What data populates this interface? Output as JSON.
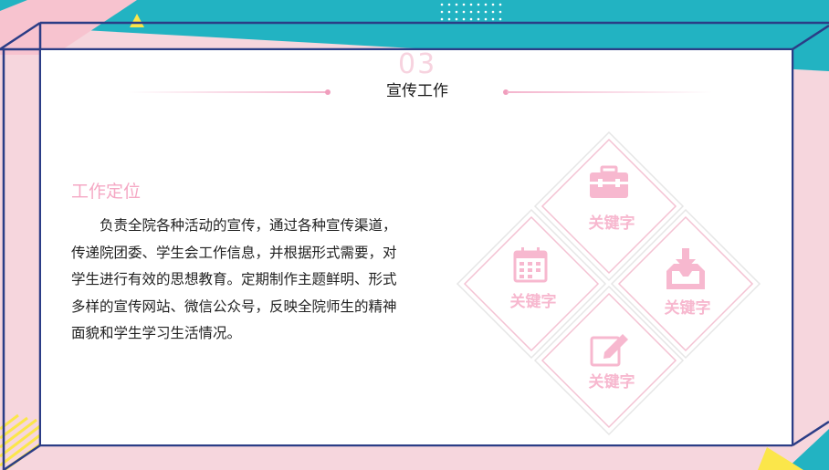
{
  "section": {
    "number": "03",
    "title": "宣传工作"
  },
  "content": {
    "subtitle": "工作定位",
    "paragraph": "负责全院各种活动的宣传，通过各种宣传渠道，传递院团委、学生会工作信息，并根据形式需要，对学生进行有效的思想教育。定期制作主题鲜明、形式多样的宣传网站、微信公众号，反映全院师生的精神面貌和学生学习生活情况。"
  },
  "keywords": [
    {
      "label": "关键字",
      "icon": "toolbox-icon"
    },
    {
      "label": "关键字",
      "icon": "calendar-icon"
    },
    {
      "label": "关键字",
      "icon": "download-tray-icon"
    },
    {
      "label": "关键字",
      "icon": "edit-icon"
    }
  ],
  "colors": {
    "teal": "#22b3c2",
    "pink": "#f6d6dd",
    "accent_pink": "#f5a8c4",
    "frame_blue": "#2b3d86",
    "yellow": "#fbe64a"
  }
}
